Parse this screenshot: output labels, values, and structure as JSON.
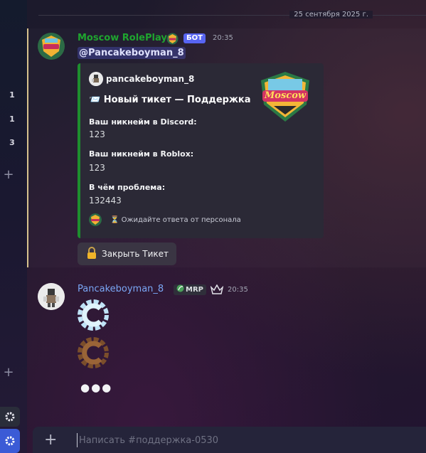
{
  "server_rail": {
    "badges": [
      "1",
      "1",
      "3"
    ],
    "plus_top": "+",
    "plus_bottom": "+",
    "gear_icon": "gear-icon"
  },
  "divider": {
    "date": "25 сентября 2025 г."
  },
  "messages": [
    {
      "author": "Moscow RolePlay",
      "author_color": "#1fa52f",
      "bot_badge": "БОТ",
      "time": "20:35",
      "mention": "@Pancakeboyman_8",
      "embed": {
        "author": "pancakeboyman_8",
        "title": "📨 Новый тикет — Поддержка",
        "thumbnail_logo_text": "Moscow",
        "fields": [
          {
            "name": "Ваш никнейм в Discord:",
            "value": "123"
          },
          {
            "name": "Ваш никнейм в Roblox:",
            "value": "123"
          },
          {
            "name": "В чём проблема:",
            "value": "132443"
          }
        ],
        "footer": "⏳ Ожидайте ответа от персонала",
        "accent_color": "#1e8e2e"
      },
      "button": {
        "icon": "lock-icon",
        "label": "Закрыть Тикет"
      }
    },
    {
      "author": "Pancakeboyman_8",
      "author_color": "#7aa7f5",
      "role_tag": "MRP",
      "crown_icon": "crown-icon",
      "time": "20:35",
      "stickers": [
        "blue-c-emoji-icon",
        "brown-c-emoji-icon"
      ],
      "typing_dots": "●●●"
    }
  ],
  "composer": {
    "plus": "+",
    "placeholder": "Написать #поддержка-0530"
  }
}
